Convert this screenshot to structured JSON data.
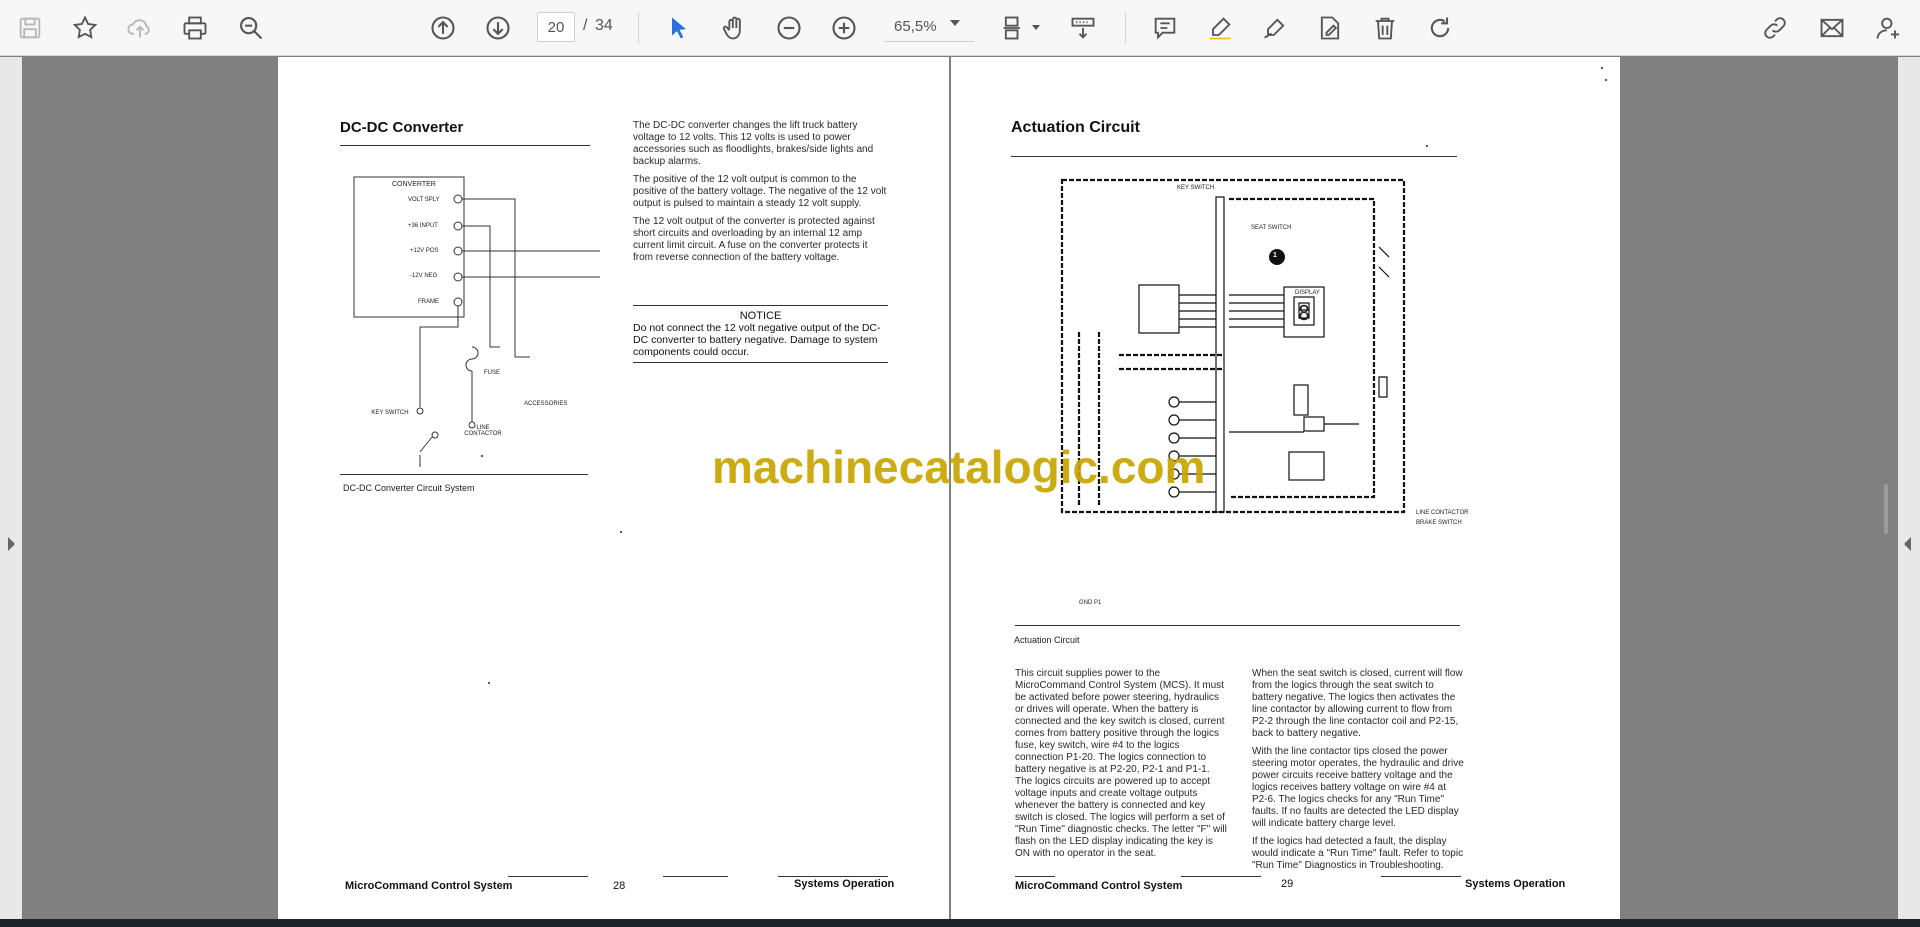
{
  "toolbar": {
    "icons": [
      "save-icon",
      "star-icon",
      "upload-icon",
      "print-icon",
      "zoom-search-icon",
      "page-up-icon",
      "page-down-icon",
      "select-cursor-icon",
      "hand-icon",
      "zoom-out-icon",
      "zoom-in-icon",
      "page-layout-icon",
      "scroll-mode-icon",
      "comment-icon",
      "highlight-icon",
      "draw-icon",
      "fill-sign-icon",
      "delete-icon",
      "rotate-icon",
      "share-link-icon",
      "email-icon",
      "add-user-icon"
    ],
    "current_page": "20",
    "page_separator": "/",
    "total_pages": "34",
    "zoom": "65,5%",
    "accent_color": "#2a6fdb"
  },
  "left_page": {
    "heading": "DC-DC Converter",
    "paragraphs": [
      "The DC-DC converter changes the lift truck battery voltage to 12 volts. This 12 volts is used to power accessories such as floodlights, brakes/side lights and backup alarms.",
      "The positive of the 12 volt output is common to the positive of the battery voltage. The negative of the 12 volt output is pulsed to maintain a steady 12 volt supply.",
      "The 12 volt output of the converter is protected against short circuits and overloading by an internal 12 amp current limit circuit. A fuse on the converter protects it from reverse connection of the battery voltage."
    ],
    "notice_title": "NOTICE",
    "notice_body": "Do not connect the 12 volt negative output of the DC-DC converter to battery negative. Damage to system components could occur.",
    "diagram_labels": {
      "box_title": "CONVERTER",
      "t1": "VOLT SPLY",
      "t2": "+36 INPUT",
      "t3": "+12V POS",
      "t4": "-12V NEG",
      "t5": "FRAME",
      "key_switch": "KEY SWITCH",
      "fuse": "FUSE",
      "line_contactor": "LINE CONTACTOR",
      "accessories": "ACCESSORIES"
    },
    "caption": "DC-DC Converter Circuit System",
    "footer_title": "MicroCommand Control System",
    "footer_page": "28",
    "footer_section": "Systems Operation"
  },
  "right_page": {
    "heading": "Actuation Circuit",
    "caption": "Actuation Circuit",
    "diagram_labels": {
      "display": "DISPLAY",
      "display_digit": "8",
      "marker": "1",
      "ground": "GND P1",
      "seat_switch": "SEAT SWITCH",
      "key_switch": "KEY SWITCH",
      "line_contactor": "LINE CONTACTOR",
      "brake_switch": "BRAKE SWITCH"
    },
    "col1": "This circuit supplies power to the MicroCommand Control System (MCS). It must be activated before power steering, hydraulics or drives will operate. When the battery is connected and the key switch is closed, current comes from battery positive through the logics fuse, key switch, wire #4 to the logics connection P1-20. The logics connection to battery negative is at P2-20, P2-1 and P1-1. The logics circuits are powered up to accept voltage inputs and create voltage outputs whenever the battery is connected and key switch is closed. The logics will perform a set of \"Run Time\" diagnostic checks. The letter \"F\" will flash on the LED display indicating the key is ON with no operator in the seat.",
    "col2_p1": "When the seat switch is closed, current will flow from the logics through the seat switch to battery negative. The logics then activates the line contactor by allowing current to flow from P2-2 through the line contactor coil and P2-15, back to battery negative.",
    "col2_p2": "With the line contactor tips closed the power steering motor operates, the hydraulic and drive power circuits receive battery voltage and the logics receives battery voltage on wire #4 at P2-6. The logics checks for any \"Run Time\" faults. If no faults are detected the LED display will indicate battery charge level.",
    "col2_p3": "If the logics had detected a fault, the display would indicate a \"Run Time\" fault. Refer to topic \"Run Time\" Diagnostics in Troubleshooting.",
    "footer_title": "MicroCommand Control System",
    "footer_page": "29",
    "footer_section": "Systems Operation"
  },
  "watermark": "machinecatalogic.com"
}
